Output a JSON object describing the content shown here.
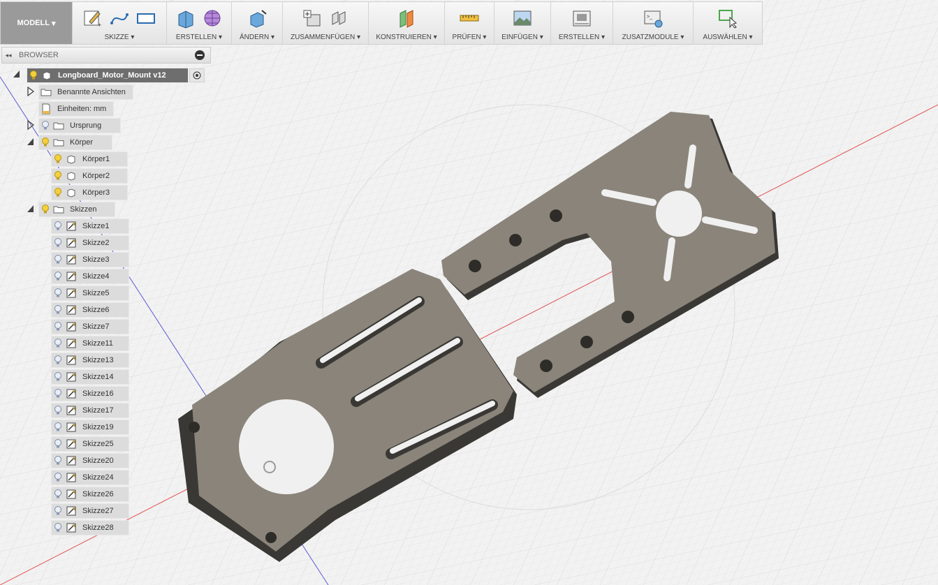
{
  "toolbar": {
    "mode": "MODELL",
    "groups": [
      {
        "label": "SKIZZE"
      },
      {
        "label": "ERSTELLEN"
      },
      {
        "label": "ÄNDERN"
      },
      {
        "label": "ZUSAMMENFÜGEN"
      },
      {
        "label": "KONSTRUIEREN"
      },
      {
        "label": "PRÜFEN"
      },
      {
        "label": "EINFÜGEN"
      },
      {
        "label": "ERSTELLEN"
      },
      {
        "label": "ZUSATZMODULE"
      },
      {
        "label": "AUSWÄHLEN"
      }
    ]
  },
  "browser": {
    "title": "BROWSER",
    "root": "Longboard_Motor_Mount v12",
    "named_views": "Benannte Ansichten",
    "units": "Einheiten: mm",
    "origin": "Ursprung",
    "bodies_folder": "Körper",
    "bodies": [
      "Körper1",
      "Körper2",
      "Körper3"
    ],
    "sketches_folder": "Skizzen",
    "sketches": [
      "Skizze1",
      "Skizze2",
      "Skizze3",
      "Skizze4",
      "Skizze5",
      "Skizze6",
      "Skizze7",
      "Skizze11",
      "Skizze13",
      "Skizze14",
      "Skizze16",
      "Skizze17",
      "Skizze19",
      "Skizze25",
      "Skizze20",
      "Skizze24",
      "Skizze26",
      "Skizze27",
      "Skizze28"
    ]
  },
  "colors": {
    "model": "#8a847a",
    "toolbar_mode_bg": "#9a9a9a",
    "root_bg": "#6e6e6e",
    "axis_red": "#e04040",
    "axis_blue": "#5050d0"
  }
}
